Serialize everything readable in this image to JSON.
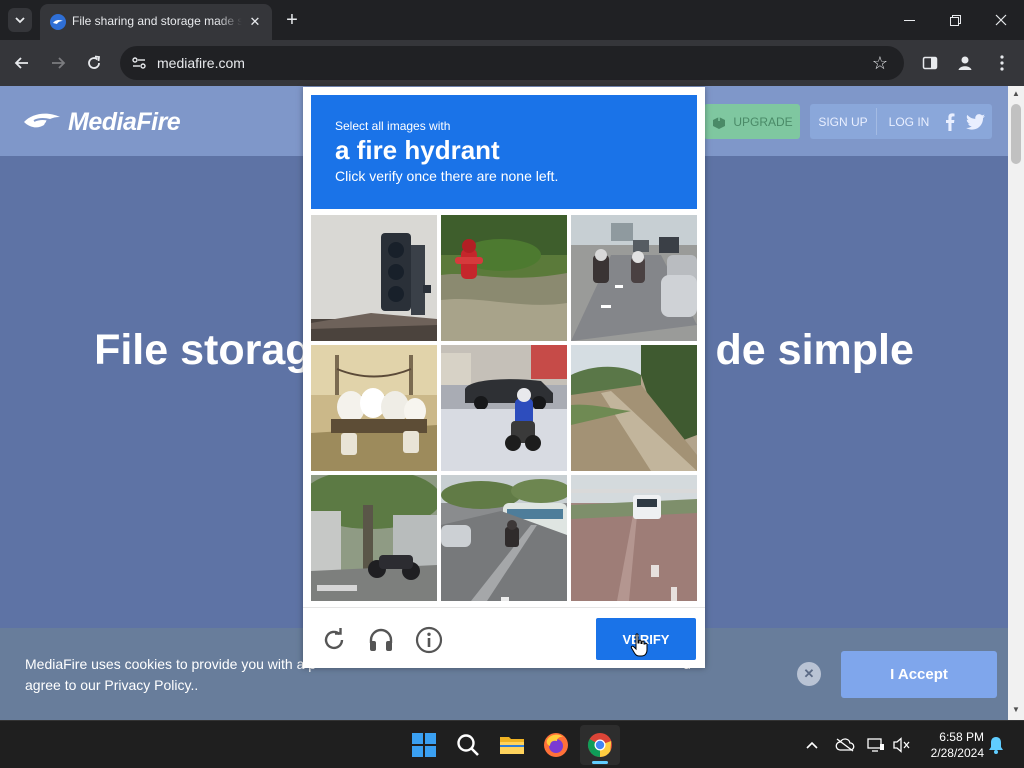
{
  "browser": {
    "tab": {
      "title": "File sharing and storage made s"
    },
    "new_tab_symbol": "+",
    "close_symbol": "✕",
    "url": "mediafire.com"
  },
  "mediafire": {
    "logo_text": "MediaFire",
    "nav": {
      "upgrade": "UPGRADE",
      "sign_up": "SIGN UP",
      "log_in": "LOG IN"
    },
    "headline_left": "File storag",
    "headline_right": "de simple",
    "cookie": {
      "line1_start": "MediaFire uses cookies to provide you with a p",
      "line1_end": "u",
      "line2": "agree to our Privacy Policy..",
      "accept": "I Accept",
      "close_symbol": "✕"
    }
  },
  "captcha": {
    "instruction_line1": "Select all images with",
    "target": "a fire hydrant",
    "instruction_line3": "Click verify once there are none left.",
    "verify": "VERIFY",
    "tiles": [
      "traffic-light",
      "fire-hydrant",
      "motorcycles-traffic",
      "white-bags",
      "motorcycle-rider",
      "country-road",
      "trees-motorcycle",
      "street-motorcycle",
      "road-truck"
    ]
  },
  "taskbar": {
    "time": "6:58 PM",
    "date": "2/28/2024"
  },
  "colors": {
    "captcha_blue": "#1a73e8",
    "page_overlay": "#5e73a5",
    "accept_button": "#7fa6ec"
  }
}
